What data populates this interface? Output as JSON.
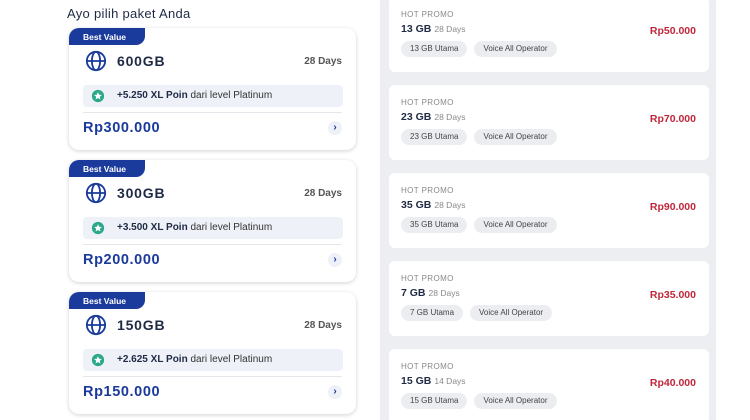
{
  "left": {
    "title": "Ayo pilih paket Anda",
    "packages": [
      {
        "badge": "Best Value",
        "quota": "600GB",
        "days": "28 Days",
        "poin_bold": "+5.250 XL Poin",
        "poin_rest": " dari level Platinum",
        "price": "Rp300.000"
      },
      {
        "badge": "Best Value",
        "quota": "300GB",
        "days": "28 Days",
        "poin_bold": "+3.500 XL Poin",
        "poin_rest": " dari level Platinum",
        "price": "Rp200.000"
      },
      {
        "badge": "Best Value",
        "quota": "150GB",
        "days": "28 Days",
        "poin_bold": "+2.625 XL Poin",
        "poin_rest": " dari level Platinum",
        "price": "Rp150.000"
      }
    ]
  },
  "right": {
    "promos": [
      {
        "label": "HOT PROMO",
        "quota": "13 GB",
        "days": "28 Days",
        "price": "Rp50.000",
        "chip1": "13 GB Utama",
        "chip2": "Voice All Operator"
      },
      {
        "label": "HOT PROMO",
        "quota": "23 GB",
        "days": "28 Days",
        "price": "Rp70.000",
        "chip1": "23 GB Utama",
        "chip2": "Voice All Operator"
      },
      {
        "label": "HOT PROMO",
        "quota": "35 GB",
        "days": "28 Days",
        "price": "Rp90.000",
        "chip1": "35 GB Utama",
        "chip2": "Voice All Operator"
      },
      {
        "label": "HOT PROMO",
        "quota": "7 GB",
        "days": "28 Days",
        "price": "Rp35.000",
        "chip1": "7 GB Utama",
        "chip2": "Voice All Operator"
      },
      {
        "label": "HOT PROMO",
        "quota": "15 GB",
        "days": "14 Days",
        "price": "Rp40.000",
        "chip1": "15 GB Utama",
        "chip2": "Voice All Operator"
      }
    ]
  },
  "colors": {
    "brand_blue": "#1a3a9c",
    "promo_red": "#c0263a"
  },
  "icons": {
    "package": "globe-icon",
    "poin": "star-badge-icon",
    "arrow": "chevron-right-icon"
  }
}
